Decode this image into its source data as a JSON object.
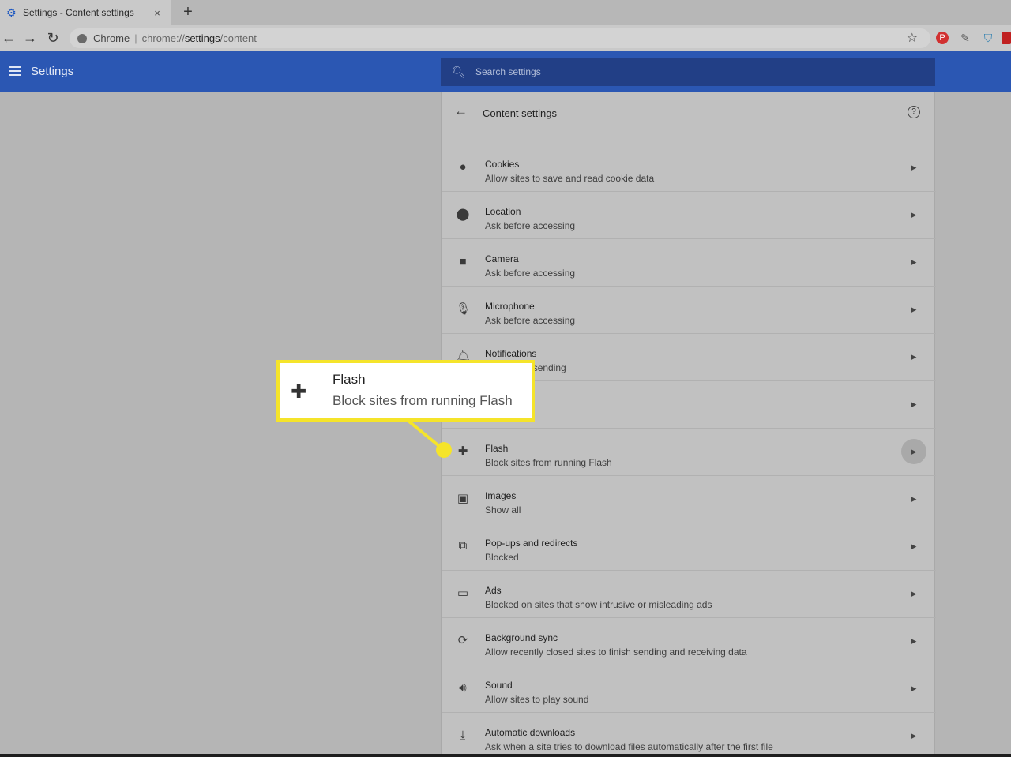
{
  "browser": {
    "tab_title": "Settings - Content settings",
    "tab_close": "×",
    "new_tab": "+",
    "omnibox_chip": "Chrome",
    "omnibox_url_prefix": "chrome://",
    "omnibox_url_path": "settings",
    "omnibox_url_suffix": "/content"
  },
  "header": {
    "title": "Settings",
    "search_placeholder": "Search settings"
  },
  "card": {
    "title": "Content settings",
    "help": "?"
  },
  "rows": [
    {
      "icon": "cookie-icon",
      "label": "Cookies",
      "sub": "Allow sites to save and read cookie data"
    },
    {
      "icon": "location-icon",
      "label": "Location",
      "sub": "Ask before accessing"
    },
    {
      "icon": "camera-icon",
      "label": "Camera",
      "sub": "Ask before accessing"
    },
    {
      "icon": "microphone-icon",
      "label": "Microphone",
      "sub": "Ask before accessing"
    },
    {
      "icon": "bell-icon",
      "label": "Notifications",
      "sub": "Ask before sending"
    },
    {
      "icon": "javascript-icon",
      "label": "",
      "sub": ""
    },
    {
      "icon": "puzzle-icon",
      "label": "Flash",
      "sub": "Block sites from running Flash"
    },
    {
      "icon": "image-icon",
      "label": "Images",
      "sub": "Show all"
    },
    {
      "icon": "open-external-icon",
      "label": "Pop-ups and redirects",
      "sub": "Blocked"
    },
    {
      "icon": "window-icon",
      "label": "Ads",
      "sub": "Blocked on sites that show intrusive or misleading ads"
    },
    {
      "icon": "sync-icon",
      "label": "Background sync",
      "sub": "Allow recently closed sites to finish sending and receiving data"
    },
    {
      "icon": "speaker-icon",
      "label": "Sound",
      "sub": "Allow sites to play sound"
    },
    {
      "icon": "download-icon",
      "label": "Automatic downloads",
      "sub": "Ask when a site tries to download files automatically after the first file"
    }
  ],
  "callout": {
    "label": "Flash",
    "sub": "Block sites from running Flash",
    "border_color": "#f5e42a"
  },
  "colors": {
    "header_blue": "#2b57b3",
    "search_blue": "#223f86"
  }
}
